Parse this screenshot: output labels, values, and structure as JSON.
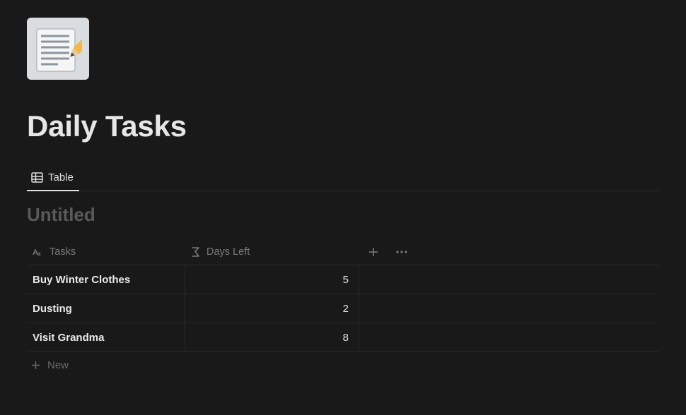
{
  "page": {
    "title": "Daily Tasks"
  },
  "tabs": {
    "active": "Table"
  },
  "database": {
    "title": "Untitled",
    "columns": {
      "tasks": "Tasks",
      "daysLeft": "Days Left"
    },
    "rows": [
      {
        "task": "Buy Winter Clothes",
        "daysLeft": "5"
      },
      {
        "task": "Dusting",
        "daysLeft": "2"
      },
      {
        "task": "Visit Grandma",
        "daysLeft": "8"
      }
    ],
    "newRow": "New"
  }
}
